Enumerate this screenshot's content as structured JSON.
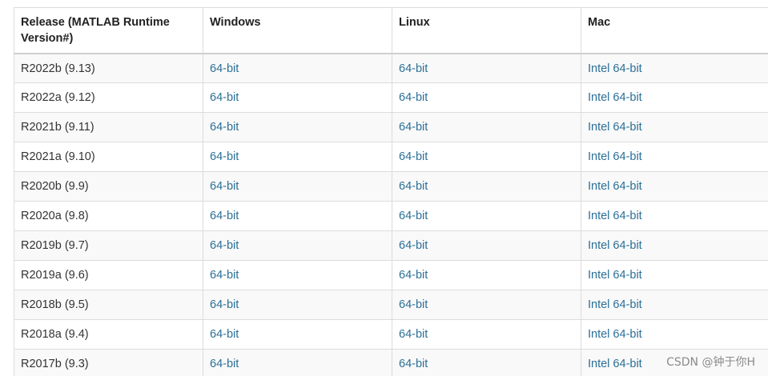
{
  "table": {
    "headers": [
      "Release (MATLAB Runtime Version#)",
      "Windows",
      "Linux",
      "Mac"
    ],
    "rows": [
      {
        "release": "R2022b (9.13)",
        "windows": "64-bit",
        "linux": "64-bit",
        "mac": "Intel 64-bit"
      },
      {
        "release": "R2022a (9.12)",
        "windows": "64-bit",
        "linux": "64-bit",
        "mac": "Intel 64-bit"
      },
      {
        "release": "R2021b (9.11)",
        "windows": "64-bit",
        "linux": "64-bit",
        "mac": "Intel 64-bit"
      },
      {
        "release": "R2021a (9.10)",
        "windows": "64-bit",
        "linux": "64-bit",
        "mac": "Intel 64-bit"
      },
      {
        "release": "R2020b (9.9)",
        "windows": "64-bit",
        "linux": "64-bit",
        "mac": "Intel 64-bit"
      },
      {
        "release": "R2020a (9.8)",
        "windows": "64-bit",
        "linux": "64-bit",
        "mac": "Intel 64-bit"
      },
      {
        "release": "R2019b (9.7)",
        "windows": "64-bit",
        "linux": "64-bit",
        "mac": "Intel 64-bit"
      },
      {
        "release": "R2019a (9.6)",
        "windows": "64-bit",
        "linux": "64-bit",
        "mac": "Intel 64-bit"
      },
      {
        "release": "R2018b (9.5)",
        "windows": "64-bit",
        "linux": "64-bit",
        "mac": "Intel 64-bit"
      },
      {
        "release": "R2018a (9.4)",
        "windows": "64-bit",
        "linux": "64-bit",
        "mac": "Intel 64-bit"
      },
      {
        "release": "R2017b (9.3)",
        "windows": "64-bit",
        "linux": "64-bit",
        "mac": "Intel 64-bit"
      }
    ]
  },
  "watermark": "CSDN @钟于你H",
  "colors": {
    "link": "#2a6f97",
    "text": "#333333",
    "header_text": "#222222",
    "border": "#dcdcdc",
    "row_alt": "#f9f9f9"
  }
}
